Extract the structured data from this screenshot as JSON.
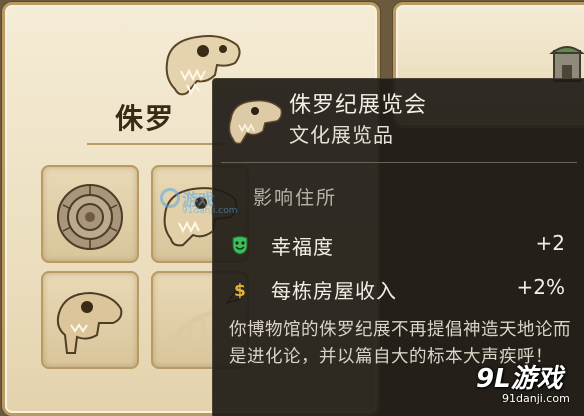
{
  "card": {
    "title": "侏罗"
  },
  "tooltip": {
    "title": "侏罗纪展览会",
    "subtitle": "文化展览品",
    "section_heading": "影响住所",
    "stats": [
      {
        "label": "幸福度",
        "value": "+2",
        "icon": "happiness-mask-icon",
        "icon_color": "#3fbf5a"
      },
      {
        "label": "每栋房屋收入",
        "value": "+2%",
        "icon": "coin-dollar-icon",
        "icon_color": "#e8b23a"
      }
    ],
    "description": "你博物馆的侏罗纪展不再提倡神造天地论而是进化论，并以篇自大的标本大声疾呼！"
  },
  "watermarks": {
    "center": {
      "main": "游戏",
      "sub": "91danji.com"
    },
    "corner": {
      "main": "9L游戏",
      "sub": "91danji.com"
    }
  },
  "colors": {
    "card_bg": "#f0e5cb",
    "card_border": "#b89a62",
    "tooltip_bg": "#1e1b16",
    "text_light": "#f3efe4",
    "text_muted": "#b9b3a4"
  }
}
